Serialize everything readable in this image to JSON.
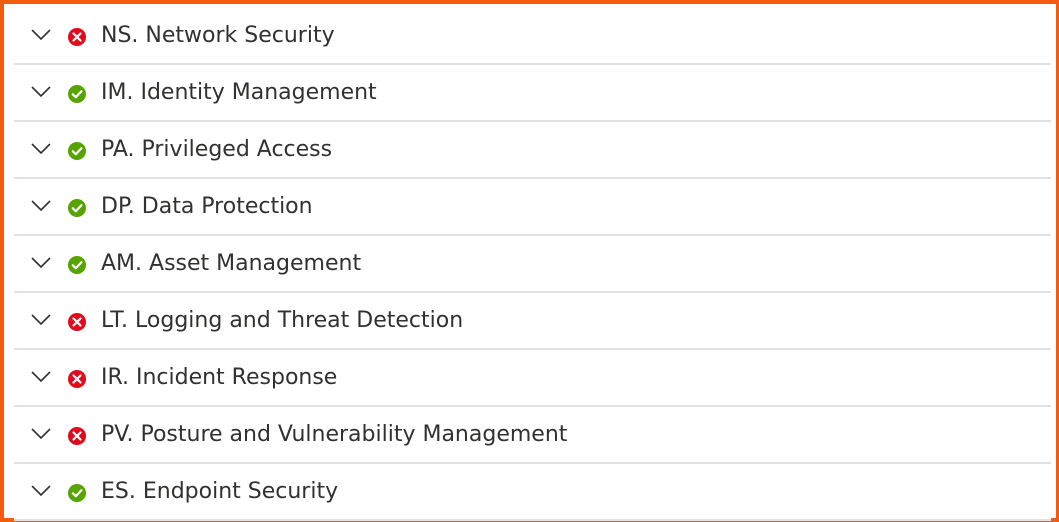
{
  "sections": [
    {
      "label": "NS. Network Security",
      "status": "fail",
      "status_icon": "error-icon"
    },
    {
      "label": "IM. Identity Management",
      "status": "pass",
      "status_icon": "check-icon"
    },
    {
      "label": "PA. Privileged Access",
      "status": "pass",
      "status_icon": "check-icon"
    },
    {
      "label": "DP. Data Protection",
      "status": "pass",
      "status_icon": "check-icon"
    },
    {
      "label": "AM. Asset Management",
      "status": "pass",
      "status_icon": "check-icon"
    },
    {
      "label": "LT. Logging and Threat Detection",
      "status": "fail",
      "status_icon": "error-icon"
    },
    {
      "label": "IR. Incident Response",
      "status": "fail",
      "status_icon": "error-icon"
    },
    {
      "label": "PV. Posture and Vulnerability Management",
      "status": "fail",
      "status_icon": "error-icon"
    },
    {
      "label": "ES. Endpoint Security",
      "status": "pass",
      "status_icon": "check-icon"
    }
  ],
  "colors": {
    "pass": "#57a300",
    "fail": "#e00b1c",
    "frame": "#f25c0f"
  }
}
